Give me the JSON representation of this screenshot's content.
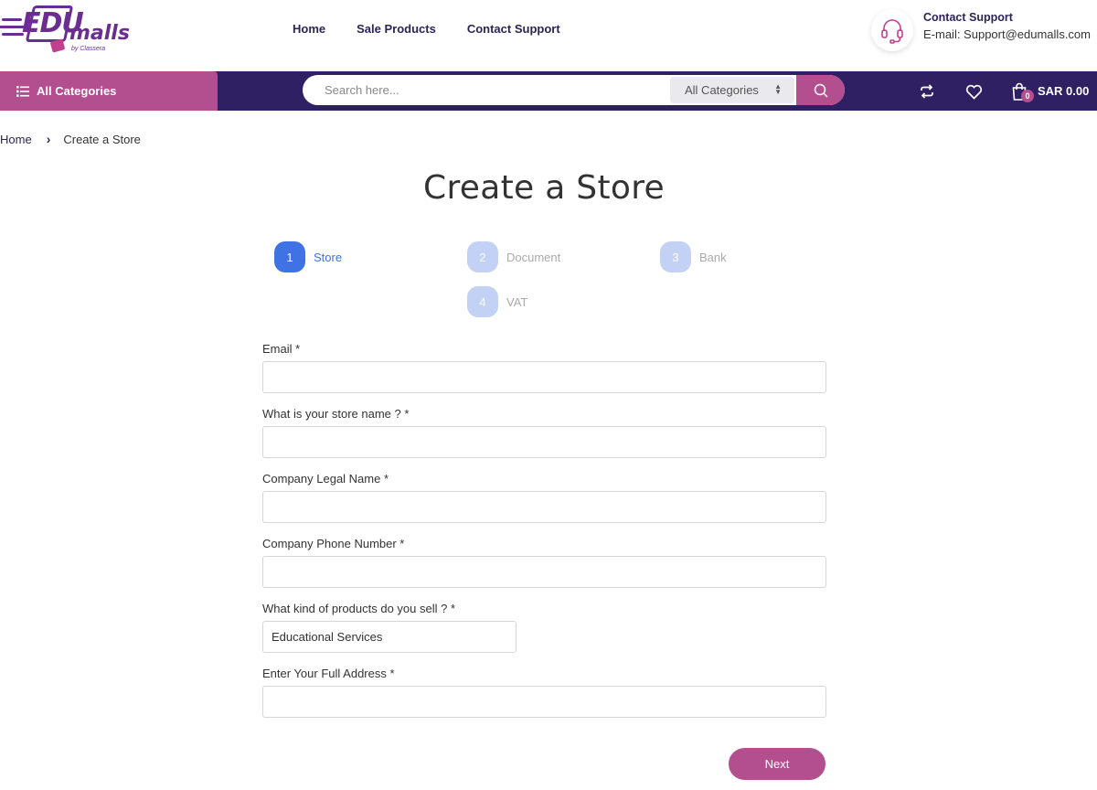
{
  "header": {
    "logo_text": "EDU malls",
    "logo_sub": "by Classera",
    "nav": [
      "Home",
      "Sale Products",
      "Contact Support"
    ],
    "support_title": "Contact Support",
    "support_email": "E-mail: Support@edumalls.com"
  },
  "navbar": {
    "all_categories": "All Categories",
    "search_placeholder": "Search here...",
    "category_select": "All Categories",
    "cart_count": "0",
    "cart_total": "SAR 0.00"
  },
  "breadcrumb": {
    "home": "Home",
    "current": "Create a Store"
  },
  "page_title": "Create a Store",
  "steps": [
    {
      "num": "1",
      "label": "Store",
      "active": true
    },
    {
      "num": "2",
      "label": "Document",
      "active": false
    },
    {
      "num": "3",
      "label": "Bank",
      "active": false
    },
    {
      "num": "4",
      "label": "VAT",
      "active": false
    }
  ],
  "form": {
    "email_label": "Email *",
    "email_value": "",
    "store_name_label": "What is your store name ? *",
    "store_name_value": "",
    "legal_name_label": "Company Legal Name *",
    "legal_name_value": "",
    "phone_label": "Company Phone Number *",
    "phone_value": "",
    "products_label": "What kind of products do you sell ? *",
    "products_value": "Educational Services",
    "address_label": "Enter Your Full Address *",
    "address_value": "",
    "next_label": "Next"
  },
  "colors": {
    "brand_purple": "#2e2062",
    "accent_pink": "#b34e8f",
    "step_active": "#3f72e4",
    "step_inactive": "#c3d1f5"
  }
}
